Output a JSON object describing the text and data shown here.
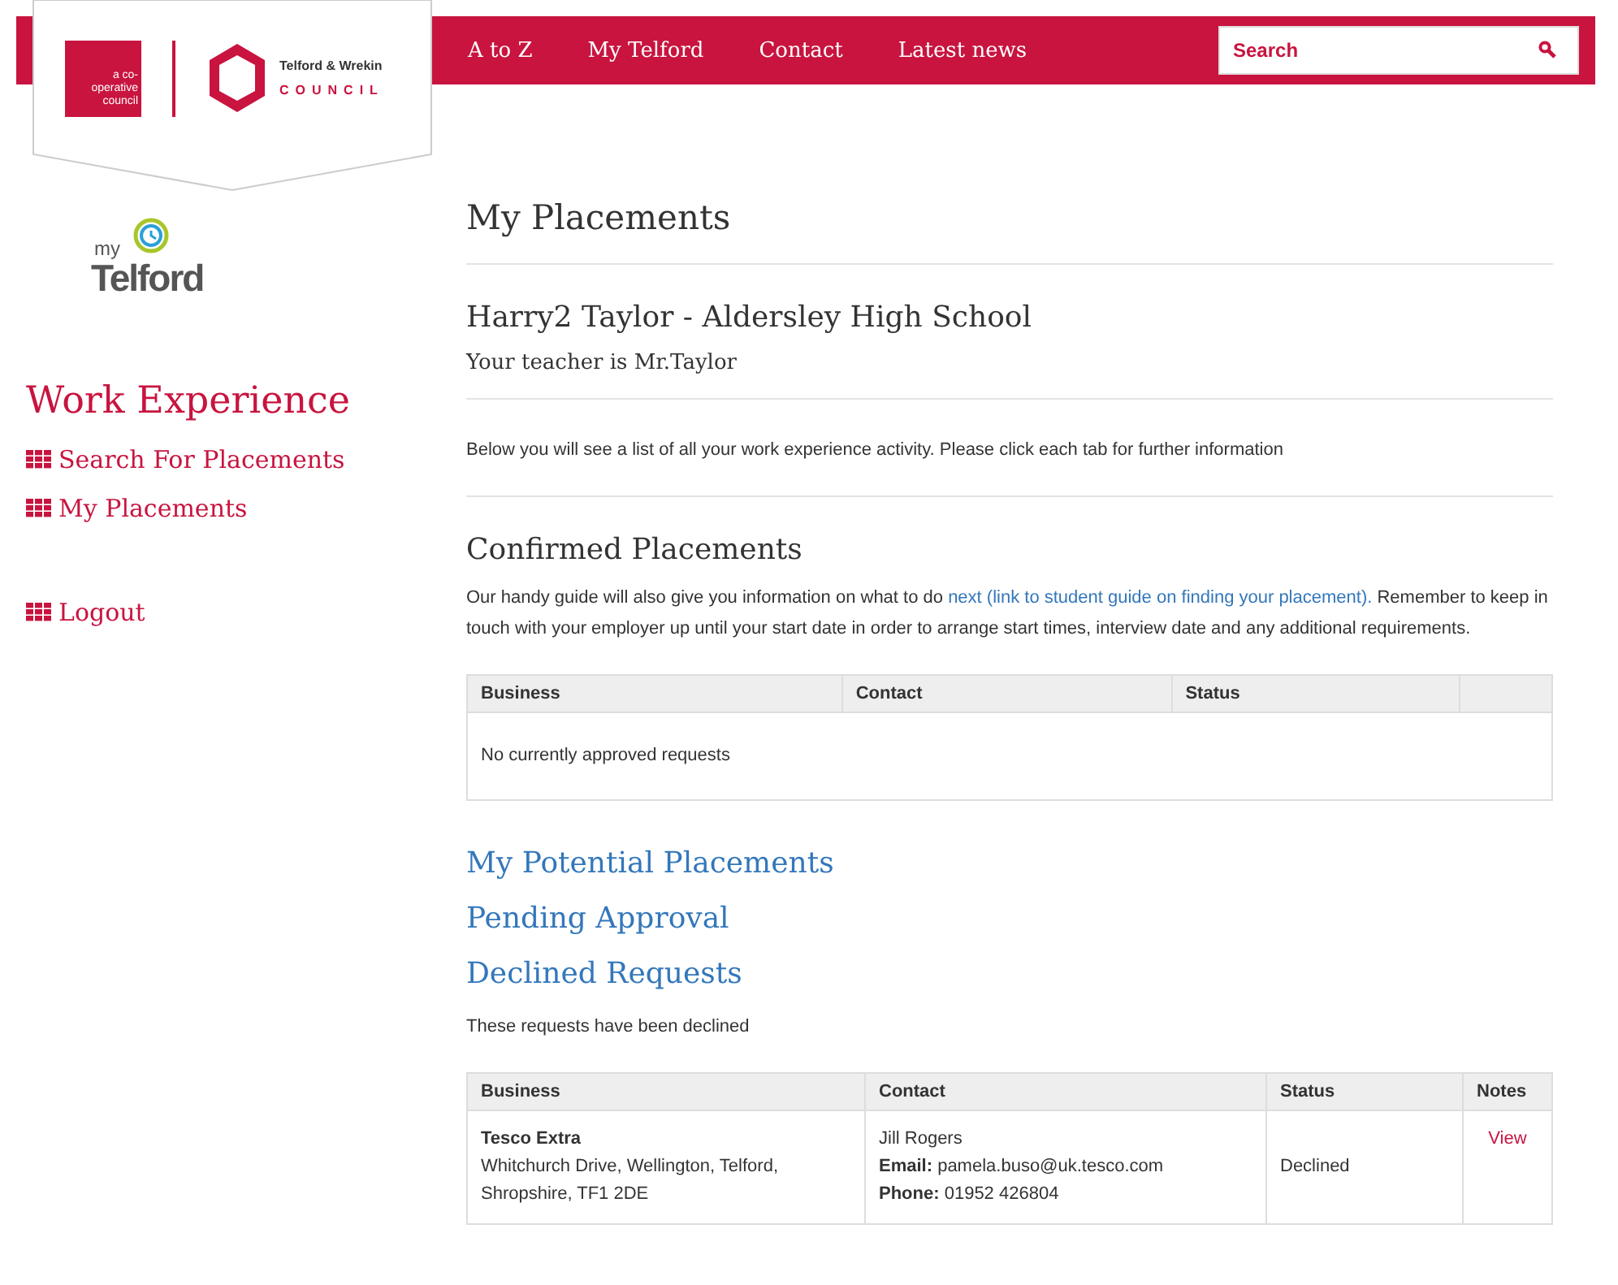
{
  "header": {
    "coop_text": "a co-operative council",
    "council_name": "Telford & Wrekin",
    "council_word": "COUNCIL",
    "nav": [
      "A to Z",
      "My Telford",
      "Contact",
      "Latest news"
    ],
    "search": {
      "placeholder": "Search"
    }
  },
  "sidebar": {
    "logo_small": "my",
    "logo_big": "Telford",
    "title": "Work Experience",
    "items": [
      {
        "label": "Search For Placements",
        "gap_before": false
      },
      {
        "label": "My Placements",
        "gap_before": false
      },
      {
        "label": "Logout",
        "gap_before": true
      }
    ]
  },
  "main": {
    "title": "My Placements",
    "student": "Harry2 Taylor - Aldersley High School",
    "teacher": "Your teacher is Mr.Taylor",
    "intro": "Below you will see a list of all your work experience activity. Please click each tab for further information",
    "confirmed": {
      "title": "Confirmed Placements",
      "text_before": "Our handy guide will also give you information on what to do ",
      "link": "next (link to student guide on finding your placement).",
      "text_after": " Remember to keep in touch with your employer up until your start date in order to arrange start times, interview date and any additional requirements.",
      "columns": [
        "Business",
        "Contact",
        "Status"
      ],
      "empty": "No currently approved requests"
    },
    "sections": [
      "My Potential Placements",
      "Pending Approval",
      "Declined Requests"
    ],
    "declined": {
      "note": "These requests have been declined",
      "columns": [
        "Business",
        "Contact",
        "Status",
        "Notes"
      ],
      "rows": [
        {
          "business": "Tesco Extra",
          "address": "Whitchurch Drive, Wellington, Telford, Shropshire, TF1 2DE",
          "contact": [
            "Jill Rogers",
            "**Email:** pamela.buso@uk.tesco.com",
            "**Phone:** 01952 426804"
          ],
          "status": "Declined",
          "notes": "View"
        }
      ]
    }
  }
}
